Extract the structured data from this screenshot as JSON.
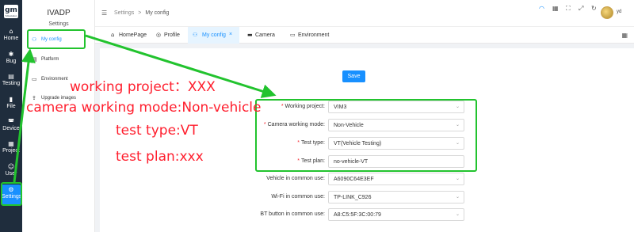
{
  "rail": {
    "logo_text": "gm",
    "logo_sub": "IVAsolution",
    "items": [
      {
        "label": "Home",
        "icon": "home-icon",
        "glyph": "⌂"
      },
      {
        "label": "Bug",
        "icon": "bug-icon",
        "glyph": "✱"
      },
      {
        "label": "Testing",
        "icon": "testing-icon",
        "glyph": "▤"
      },
      {
        "label": "File",
        "icon": "file-icon",
        "glyph": "▮"
      },
      {
        "label": "Device",
        "icon": "car-icon",
        "glyph": "◚"
      },
      {
        "label": "Project",
        "icon": "project-icon",
        "glyph": "▦"
      },
      {
        "label": "User",
        "icon": "user-icon",
        "glyph": "☺"
      },
      {
        "label": "Settings",
        "icon": "gear-icon",
        "glyph": "⚙"
      }
    ]
  },
  "sidebar": {
    "title": "IVADP",
    "subtitle": "Settings",
    "items": [
      {
        "label": "My config",
        "icon": "user-config-icon",
        "glyph": "⚇"
      },
      {
        "label": "Platform",
        "icon": "platform-icon",
        "glyph": "▤"
      },
      {
        "label": "Environment",
        "icon": "environment-icon",
        "glyph": "▭"
      },
      {
        "label": "Upgrade images",
        "icon": "upgrade-icon",
        "glyph": "⇪"
      }
    ]
  },
  "topbar": {
    "breadcrumb": [
      "Settings",
      "My config"
    ],
    "separator": ">",
    "user": "yd"
  },
  "tabs": [
    {
      "label": "HomePage",
      "icon": "home-icon",
      "glyph": "⌂"
    },
    {
      "label": "Profile",
      "icon": "profile-icon",
      "glyph": "◎"
    },
    {
      "label": "My config",
      "icon": "user-config-icon",
      "glyph": "⚇",
      "closable": "×"
    },
    {
      "label": "Camera",
      "icon": "camera-icon",
      "glyph": "▬"
    },
    {
      "label": "Environment",
      "icon": "environment-icon",
      "glyph": "▭"
    }
  ],
  "form": {
    "save_label": "Save",
    "required_mark": "*",
    "fields": [
      {
        "label": "Working project:",
        "value": "VIM3",
        "required": true,
        "type": "select"
      },
      {
        "label": "Camera working mode:",
        "value": "Non-Vehicle",
        "required": true,
        "type": "select"
      },
      {
        "label": "Test type:",
        "value": "VT(Vehicle Testing)",
        "required": true,
        "type": "select"
      },
      {
        "label": "Test plan:",
        "value": "no-vehicle-VT",
        "required": true,
        "type": "input"
      },
      {
        "label": "Vehicle in common use:",
        "value": "A6090C64E3EF",
        "required": false,
        "type": "select"
      },
      {
        "label": "Wi-Fi in common use:",
        "value": "TP-LINK_C926",
        "required": false,
        "type": "select"
      },
      {
        "label": "BT button in common use:",
        "value": "A8:C5:5F:3C:00:79",
        "required": false,
        "type": "select"
      }
    ]
  },
  "annotations": {
    "line1": "working project：XXX",
    "line2": "camera working mode:Non-vehicle",
    "line3": "test type:VT",
    "line4": "test plan:xxx"
  },
  "colors": {
    "accent": "#1890ff",
    "rail_bg": "#1f2d3d",
    "annotation_red": "#ff1f2e",
    "highlight_green": "#22c32e"
  }
}
